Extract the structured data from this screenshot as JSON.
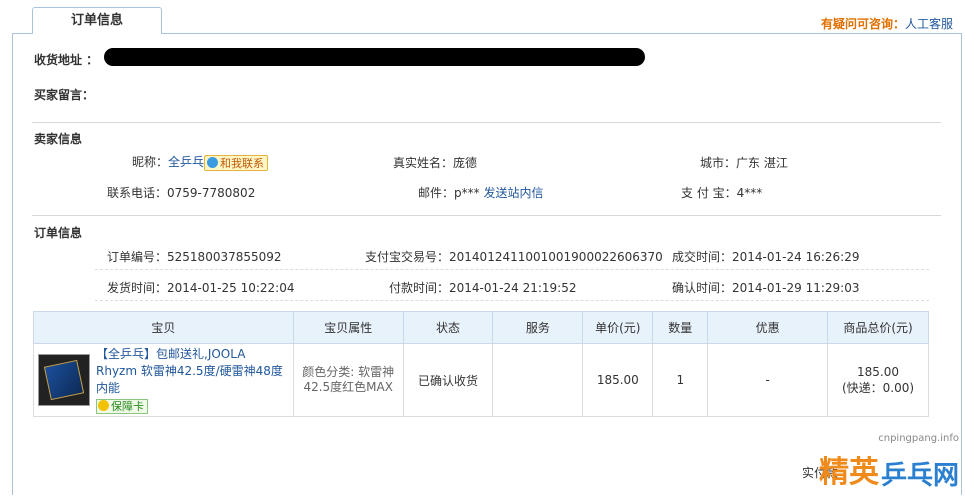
{
  "tab": {
    "title": "订单信息"
  },
  "help": {
    "question": "有疑问可咨询：",
    "service": "人工客服"
  },
  "buyer": {
    "address_label": "收货地址 ：",
    "message_label": "买家留言："
  },
  "seller": {
    "section": "卖家信息",
    "nickname_label": "昵称：",
    "nickname": "全乒乓",
    "chat": "和我联系",
    "realname_label": "真实姓名：",
    "realname": "庞德",
    "city_label": "城市：",
    "city": "广东 湛江",
    "phone_label": "联系电话：",
    "phone": "0759-7780802",
    "mail_label": "邮件：",
    "mail": "p***",
    "mail_link": "发送站内信",
    "alipay_label": "支 付 宝：",
    "alipay": "4***"
  },
  "order": {
    "section": "订单信息",
    "no_label": "订单编号：",
    "no": "525180037855092",
    "alipay_tx_label": "支付宝交易号：",
    "alipay_tx": "2014012411001001900022606370",
    "deal_time_label": "成交时间：",
    "deal_time": "2014-01-24 16:26:29",
    "ship_time_label": "发货时间：",
    "ship_time": "2014-01-25 10:22:04",
    "pay_time_label": "付款时间：",
    "pay_time": "2014-01-24 21:19:52",
    "confirm_time_label": "确认时间：",
    "confirm_time": "2014-01-29 11:29:03"
  },
  "table": {
    "headers": [
      "宝贝",
      "宝贝属性",
      "状态",
      "服务",
      "单价(元)",
      "数量",
      "优惠",
      "商品总价(元)"
    ],
    "row": {
      "title": "【全乒乓】包邮送礼,JOOLA Rhyzm 软雷神42.5度/硬雷神48度 内能",
      "guard": "保障卡",
      "attr": "颜色分类: 软雷神42.5度红色MAX",
      "status": "已确认收货",
      "service": "",
      "price": "185.00",
      "qty": "1",
      "discount": "-",
      "total": "185.00",
      "shipping": "(快递：0.00)"
    }
  },
  "footer": {
    "paid_label": "实付款"
  },
  "watermark": {
    "site": "cnpingpang.info",
    "jingying": "精英",
    "net": "乒乓网"
  },
  "colors": {
    "link": "#21579b",
    "accent": "#e07000",
    "border": "#aac3dc",
    "table_header": "#e8f2fb"
  }
}
